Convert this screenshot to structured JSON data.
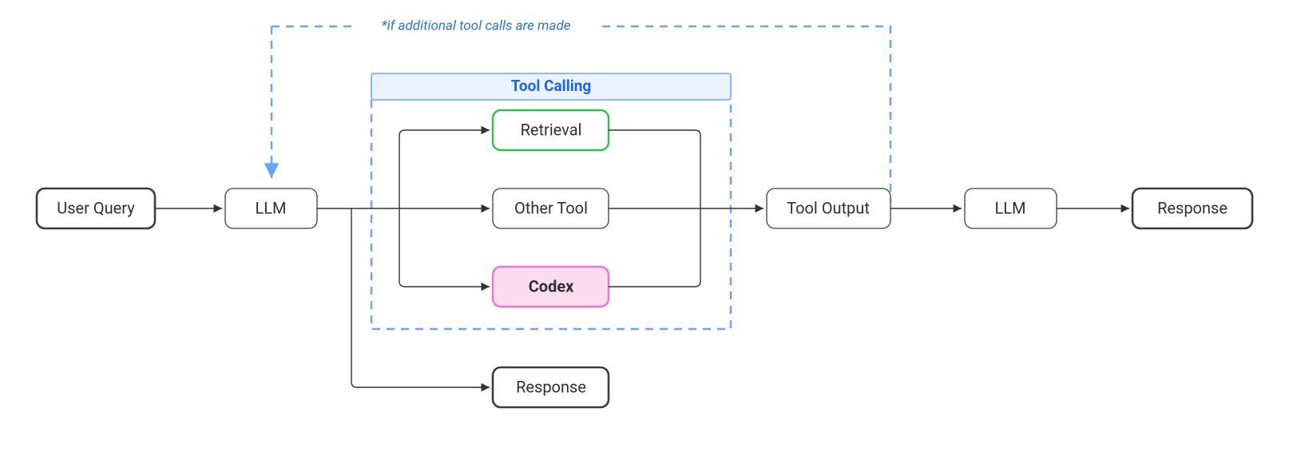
{
  "annotation": "*if additional tool calls are made",
  "group": {
    "title": "Tool Calling"
  },
  "nodes": {
    "user_query": {
      "label": "User Query"
    },
    "llm1": {
      "label": "LLM"
    },
    "retrieval": {
      "label": "Retrieval"
    },
    "other_tool": {
      "label": "Other Tool"
    },
    "codex": {
      "label": "Codex"
    },
    "tool_output": {
      "label": "Tool Output"
    },
    "llm2": {
      "label": "LLM"
    },
    "response2": {
      "label": "Response"
    },
    "response1": {
      "label": "Response"
    }
  },
  "colors": {
    "dashed_blue": "#6aa5f4",
    "group_header_fill": "#e9f2fe",
    "group_header_stroke": "#7fb0ec",
    "dark_stroke": "#383d43",
    "green_stroke": "#2fbf4a",
    "pink_stroke": "#f372c1",
    "pink_fill": "#fbddef",
    "arrow": "#2e3338"
  }
}
